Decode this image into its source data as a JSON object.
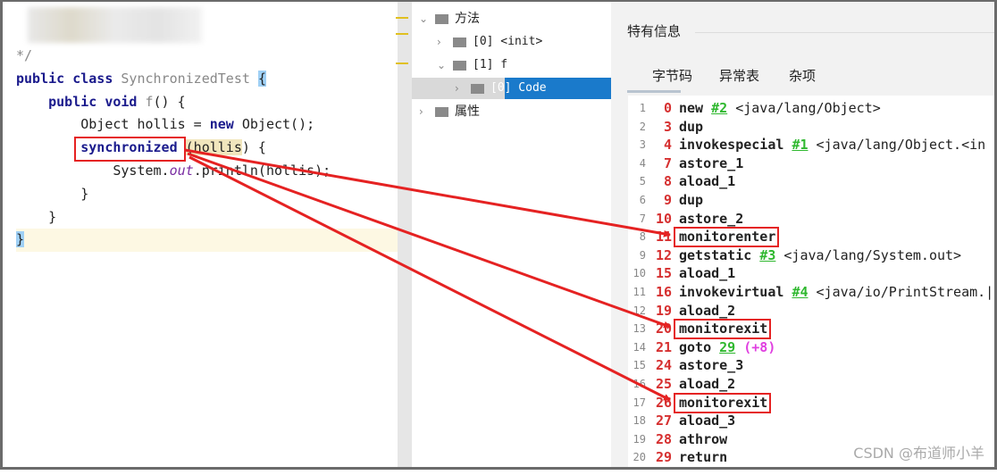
{
  "editor": {
    "lines": [
      {
        "parts": [
          {
            "t": "*/",
            "c": "gray"
          }
        ]
      },
      {
        "parts": [
          {
            "t": "public class ",
            "c": "kw"
          },
          {
            "t": "SynchronizedTest ",
            "c": "gray"
          },
          {
            "t": "{",
            "c": "brace"
          }
        ]
      },
      {
        "parts": [
          {
            "t": "    public void ",
            "c": "kw"
          },
          {
            "t": "f",
            "c": "gray"
          },
          {
            "t": "() {",
            "c": ""
          }
        ]
      },
      {
        "parts": [
          {
            "t": "        Object hollis = ",
            "c": ""
          },
          {
            "t": "new",
            "c": "kw"
          },
          {
            "t": " Object();",
            "c": ""
          }
        ]
      },
      {
        "parts": [
          {
            "t": "        ",
            "c": ""
          },
          {
            "t": "synchronized",
            "c": "kw"
          },
          {
            "t": " ",
            "c": ""
          },
          {
            "t": "(hollis",
            "c": "hl"
          },
          {
            "t": ") {",
            "c": ""
          }
        ]
      },
      {
        "parts": [
          {
            "t": "            System.",
            "c": ""
          },
          {
            "t": "out",
            "c": "it"
          },
          {
            "t": ".println(hollis);",
            "c": ""
          }
        ]
      },
      {
        "parts": [
          {
            "t": "        }",
            "c": ""
          }
        ]
      },
      {
        "parts": [
          {
            "t": "    }",
            "c": ""
          }
        ]
      },
      {
        "parts": [
          {
            "t": "}",
            "c": "brace"
          }
        ]
      }
    ]
  },
  "tree": {
    "items": [
      {
        "label": "方法",
        "expanded": true
      },
      {
        "label": "[0] <init>",
        "expanded": false
      },
      {
        "label": "[1] f",
        "expanded": true
      },
      {
        "label": "[0] Code",
        "expanded": false,
        "selected": true
      },
      {
        "label": "属性",
        "expanded": false
      }
    ]
  },
  "panel": {
    "title": "特有信息",
    "tabs": [
      "字节码",
      "异常表",
      "杂项"
    ],
    "active_tab": "字节码"
  },
  "bytecode": [
    {
      "n": "1",
      "off": "0",
      "op": "new",
      "ref": "#2",
      "arg": "<java/lang/Object>"
    },
    {
      "n": "2",
      "off": "3",
      "op": "dup"
    },
    {
      "n": "3",
      "off": "4",
      "op": "invokespecial",
      "ref": "#1",
      "arg": "<java/lang/Object.<in"
    },
    {
      "n": "4",
      "off": "7",
      "op": "astore_1"
    },
    {
      "n": "5",
      "off": "8",
      "op": "aload_1"
    },
    {
      "n": "6",
      "off": "9",
      "op": "dup"
    },
    {
      "n": "7",
      "off": "10",
      "op": "astore_2"
    },
    {
      "n": "8",
      "off": "11",
      "op": "monitorenter",
      "boxed": true
    },
    {
      "n": "9",
      "off": "12",
      "op": "getstatic",
      "ref": "#3",
      "arg": "<java/lang/System.out>"
    },
    {
      "n": "10",
      "off": "15",
      "op": "aload_1"
    },
    {
      "n": "11",
      "off": "16",
      "op": "invokevirtual",
      "ref": "#4",
      "arg": "<java/io/PrintStream.|"
    },
    {
      "n": "12",
      "off": "19",
      "op": "aload_2"
    },
    {
      "n": "13",
      "off": "20",
      "op": "monitorexit",
      "boxed": true
    },
    {
      "n": "14",
      "off": "21",
      "op": "goto",
      "ref": "29",
      "extra": "(+8)"
    },
    {
      "n": "15",
      "off": "24",
      "op": "astore_3"
    },
    {
      "n": "16",
      "off": "25",
      "op": "aload_2"
    },
    {
      "n": "17",
      "off": "26",
      "op": "monitorexit",
      "boxed": true
    },
    {
      "n": "18",
      "off": "27",
      "op": "aload_3"
    },
    {
      "n": "19",
      "off": "28",
      "op": "athrow"
    },
    {
      "n": "20",
      "off": "29",
      "op": "return"
    }
  ],
  "annotation_color": "#e52222",
  "watermark": "CSDN @布道师小羊"
}
